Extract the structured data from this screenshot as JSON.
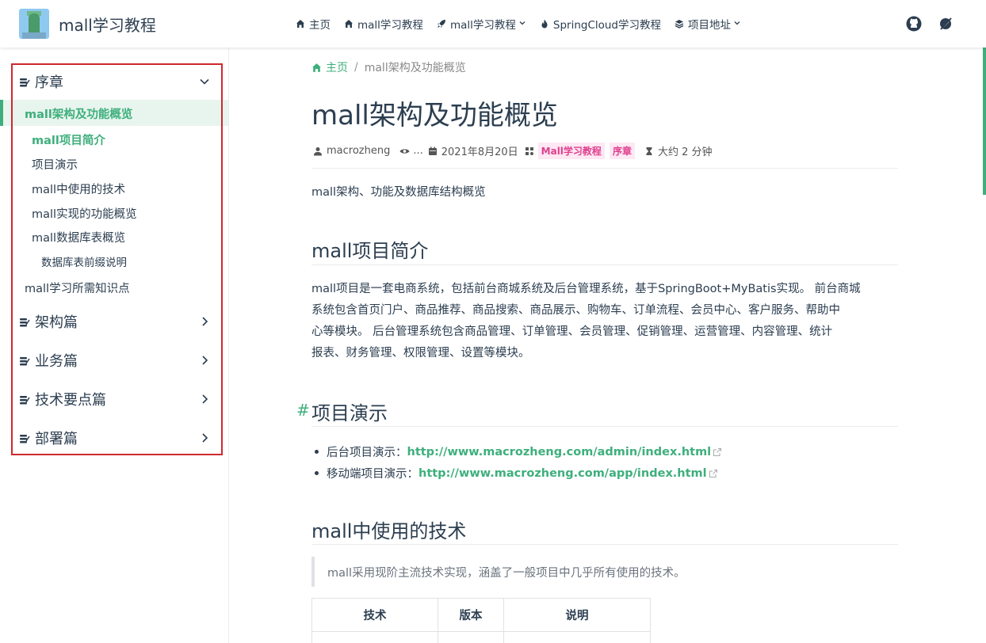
{
  "navbar": {
    "title": "mall学习教程",
    "links": [
      {
        "label": "主页",
        "icon": "home-icon",
        "dropdown": false
      },
      {
        "label": "mall学习教程",
        "icon": "home-icon",
        "dropdown": false
      },
      {
        "label": "mall学习教程",
        "icon": "rocket-icon",
        "dropdown": true
      },
      {
        "label": "SpringCloud学习教程",
        "icon": "fire-icon",
        "dropdown": false
      },
      {
        "label": "项目地址",
        "icon": "layers-icon",
        "dropdown": true
      }
    ],
    "right_icons": [
      "github-icon",
      "theme-toggle-icon"
    ]
  },
  "sidebar": {
    "groups": [
      {
        "label": "序章",
        "expanded": true
      },
      {
        "label": "架构篇",
        "expanded": false
      },
      {
        "label": "业务篇",
        "expanded": false
      },
      {
        "label": "技术要点篇",
        "expanded": false
      },
      {
        "label": "部署篇",
        "expanded": false
      }
    ],
    "items": [
      {
        "label": "mall架构及功能概览",
        "active": true
      },
      {
        "label": "mall项目简介",
        "active": true
      },
      {
        "label": "项目演示",
        "active": false
      },
      {
        "label": "mall中使用的技术",
        "active": false
      },
      {
        "label": "mall实现的功能概览",
        "active": false
      },
      {
        "label": "mall数据库表概览",
        "active": false
      },
      {
        "label": "数据库表前缀说明",
        "active": false
      },
      {
        "label": "mall学习所需知识点",
        "active": false
      }
    ]
  },
  "breadcrumb": {
    "home": "主页",
    "separator": "/",
    "current": "mall架构及功能概览"
  },
  "page": {
    "title": "mall架构及功能概览",
    "meta": {
      "author": "macrozheng",
      "views": "...",
      "date": "2021年8月20日",
      "tags": [
        "Mall学习教程",
        "序章"
      ],
      "reading_time": "大约 2 分钟"
    },
    "summary": "mall架构、功能及数据库结构概览",
    "section1": {
      "title": "mall项目简介",
      "lines": [
        "mall项目是一套电商系统，包括前台商城系统及后台管理系统，基于SpringBoot+MyBatis实现。 前台商城",
        "系统包含首页门户、商品推荐、商品搜索、商品展示、购物车、订单流程、会员中心、客户服务、帮助中",
        "心等模块。 后台管理系统包含商品管理、订单管理、会员管理、促销管理、运营管理、内容管理、统计",
        "报表、财务管理、权限管理、设置等模块。"
      ]
    },
    "section2": {
      "hash": "#",
      "title": "项目演示",
      "items": [
        {
          "label": "后台项目演示：",
          "link": "http://www.macrozheng.com/admin/index.html"
        },
        {
          "label": "移动端项目演示：",
          "link": "http://www.macrozheng.com/app/index.html"
        }
      ]
    },
    "section3": {
      "title": "mall中使用的技术",
      "quote": "mall采用现阶主流技术实现，涵盖了一般项目中几乎所有使用的技术。",
      "table_headers": [
        "技术",
        "版本",
        "说明"
      ]
    }
  },
  "colors": {
    "accent": "#3eaf7c",
    "highlight_frame": "#d0282e",
    "tag_text": "#e0408f",
    "tag_bg": "#fde8f3"
  }
}
